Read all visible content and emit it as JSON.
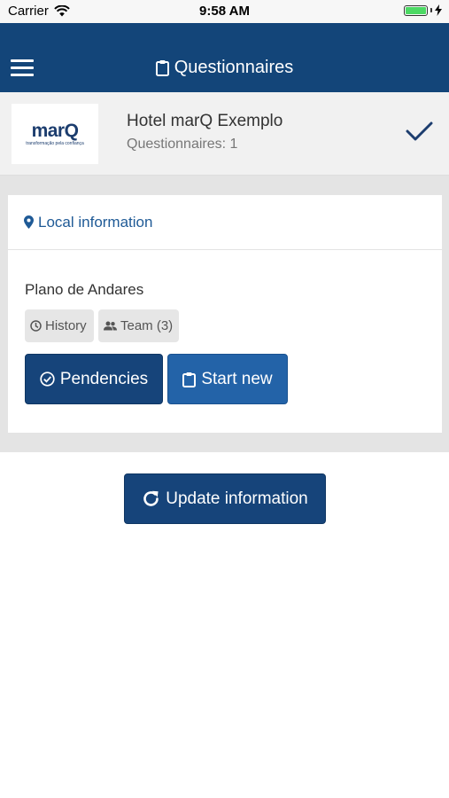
{
  "status_bar": {
    "carrier": "Carrier",
    "time": "9:58 AM"
  },
  "nav": {
    "title": "Questionnaires"
  },
  "hotel": {
    "logo_word": "marQ",
    "logo_tagline": "transformação pela confiança",
    "name": "Hotel marQ Exemplo",
    "count_text": "Questionnaires: 1"
  },
  "local": {
    "header": "Local information",
    "item_name": "Plano de Andares",
    "history_label": "History",
    "team_label": "Team (3)",
    "pendencies_label": "Pendencies",
    "start_new_label": "Start new"
  },
  "actions": {
    "update_label": "Update information"
  },
  "colors": {
    "primary": "#134579",
    "accent": "#2363a8",
    "battery": "#4cd964"
  }
}
